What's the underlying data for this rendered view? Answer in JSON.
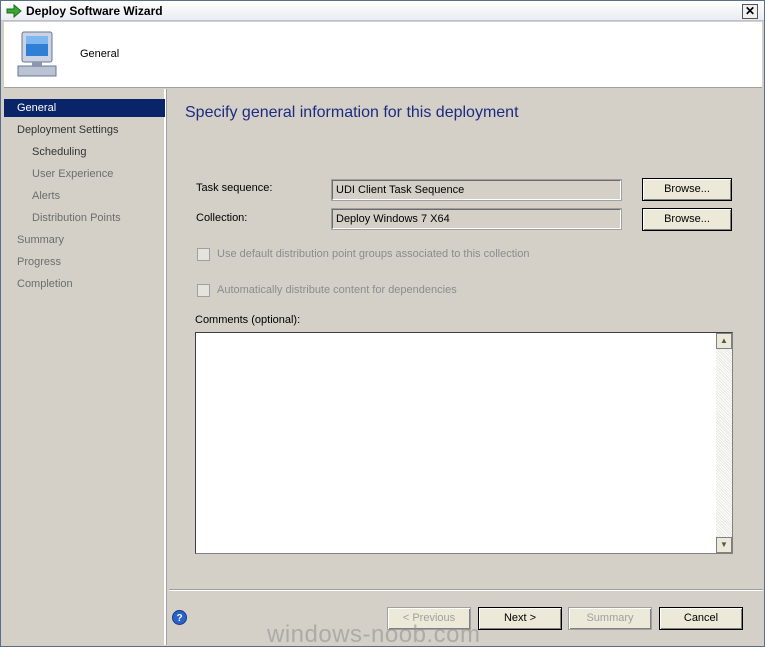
{
  "window": {
    "title": "Deploy Software Wizard",
    "close_glyph": "✕"
  },
  "banner": {
    "title": "General",
    "icon": "computer-icon"
  },
  "sidebar": {
    "items": [
      {
        "label": "General",
        "state": "selected"
      },
      {
        "label": "Deployment Settings",
        "state": "normal"
      },
      {
        "label": "Scheduling",
        "state": "normal"
      },
      {
        "label": "User Experience",
        "state": "disabled"
      },
      {
        "label": "Alerts",
        "state": "disabled"
      },
      {
        "label": "Distribution Points",
        "state": "disabled"
      },
      {
        "label": "Summary",
        "state": "disabled"
      },
      {
        "label": "Progress",
        "state": "disabled"
      },
      {
        "label": "Completion",
        "state": "disabled"
      }
    ]
  },
  "main": {
    "heading": "Specify general information for this deployment",
    "task_sequence": {
      "label": "Task sequence:",
      "value": "UDI Client Task Sequence",
      "browse": "Browse..."
    },
    "collection": {
      "label": "Collection:",
      "value": "Deploy Windows 7 X64",
      "browse": "Browse..."
    },
    "checkbox_dp_groups": {
      "label": "Use default distribution point groups associated to this collection",
      "checked": false
    },
    "checkbox_dependencies": {
      "label": "Automatically distribute content for dependencies",
      "checked": false
    },
    "comments": {
      "label": "Comments (optional):",
      "value": ""
    }
  },
  "footer": {
    "previous": "< Previous",
    "next": "Next >",
    "summary": "Summary",
    "cancel": "Cancel",
    "help_glyph": "?"
  },
  "watermark": "windows-noob.com",
  "colors": {
    "selected_nav": "#0a246a",
    "heading": "#1b2c80",
    "dialog_bg": "#d4d0c8"
  }
}
